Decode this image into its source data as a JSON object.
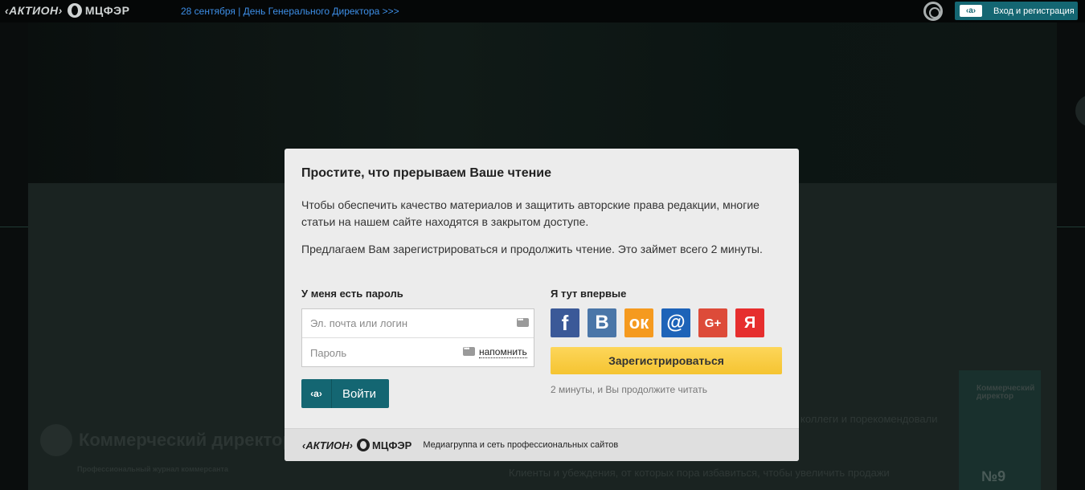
{
  "topbar": {
    "brand_aktion": "‹АКТИОН›",
    "brand_mcfer": "МЦФЭР",
    "event_link": "28 сентября | День Генерального Директора >>>",
    "login_badge": "‹а›",
    "login_label": "Вход и регистрация"
  },
  "background": {
    "logo_title": "Коммерческий директор",
    "logo_subtitle": "Профессиональный журнал коммерсанта",
    "text_right": "коллеги и порекомендовали",
    "text_bottom": "Клиенты и убеждения, от которых пора избавиться, чтобы увеличить продажи",
    "magazine_title": "Коммерческий директор",
    "magazine_number": "№9"
  },
  "modal": {
    "title": "Простите, что прерываем Ваше чтение",
    "paragraph1": "Чтобы обеспечить качество материалов и защитить авторские права редакции, многие статьи на нашем сайте находятся в закрытом доступе.",
    "paragraph2": "Предлагаем Вам зарегистрироваться и продолжить чтение. Это займет всего 2 минуты.",
    "login_col_title": "У меня есть пароль",
    "register_col_title": "Я тут впервые",
    "email_placeholder": "Эл. почта или логин",
    "password_placeholder": "Пароль",
    "remind_label": "напомнить",
    "enter_badge": "‹а›",
    "enter_label": "Войти",
    "social": [
      {
        "name": "facebook",
        "glyph": "f"
      },
      {
        "name": "vkontakte",
        "glyph": "B"
      },
      {
        "name": "odnoklassniki",
        "glyph": "ок"
      },
      {
        "name": "mailru",
        "glyph": "@"
      },
      {
        "name": "googleplus",
        "glyph": "G+"
      },
      {
        "name": "yandex",
        "glyph": "Я"
      }
    ],
    "register_label": "Зарегистрироваться",
    "register_note": "2 минуты, и Вы продолжите читать",
    "footer_aktion": "‹АКТИОН›",
    "footer_mcfer": "МЦФЭР",
    "footer_text": "Медиагруппа и сеть профессиональных сайтов"
  },
  "colors": {
    "accent": "#146672",
    "link": "#3d8ee6",
    "register": "#f5c431"
  }
}
